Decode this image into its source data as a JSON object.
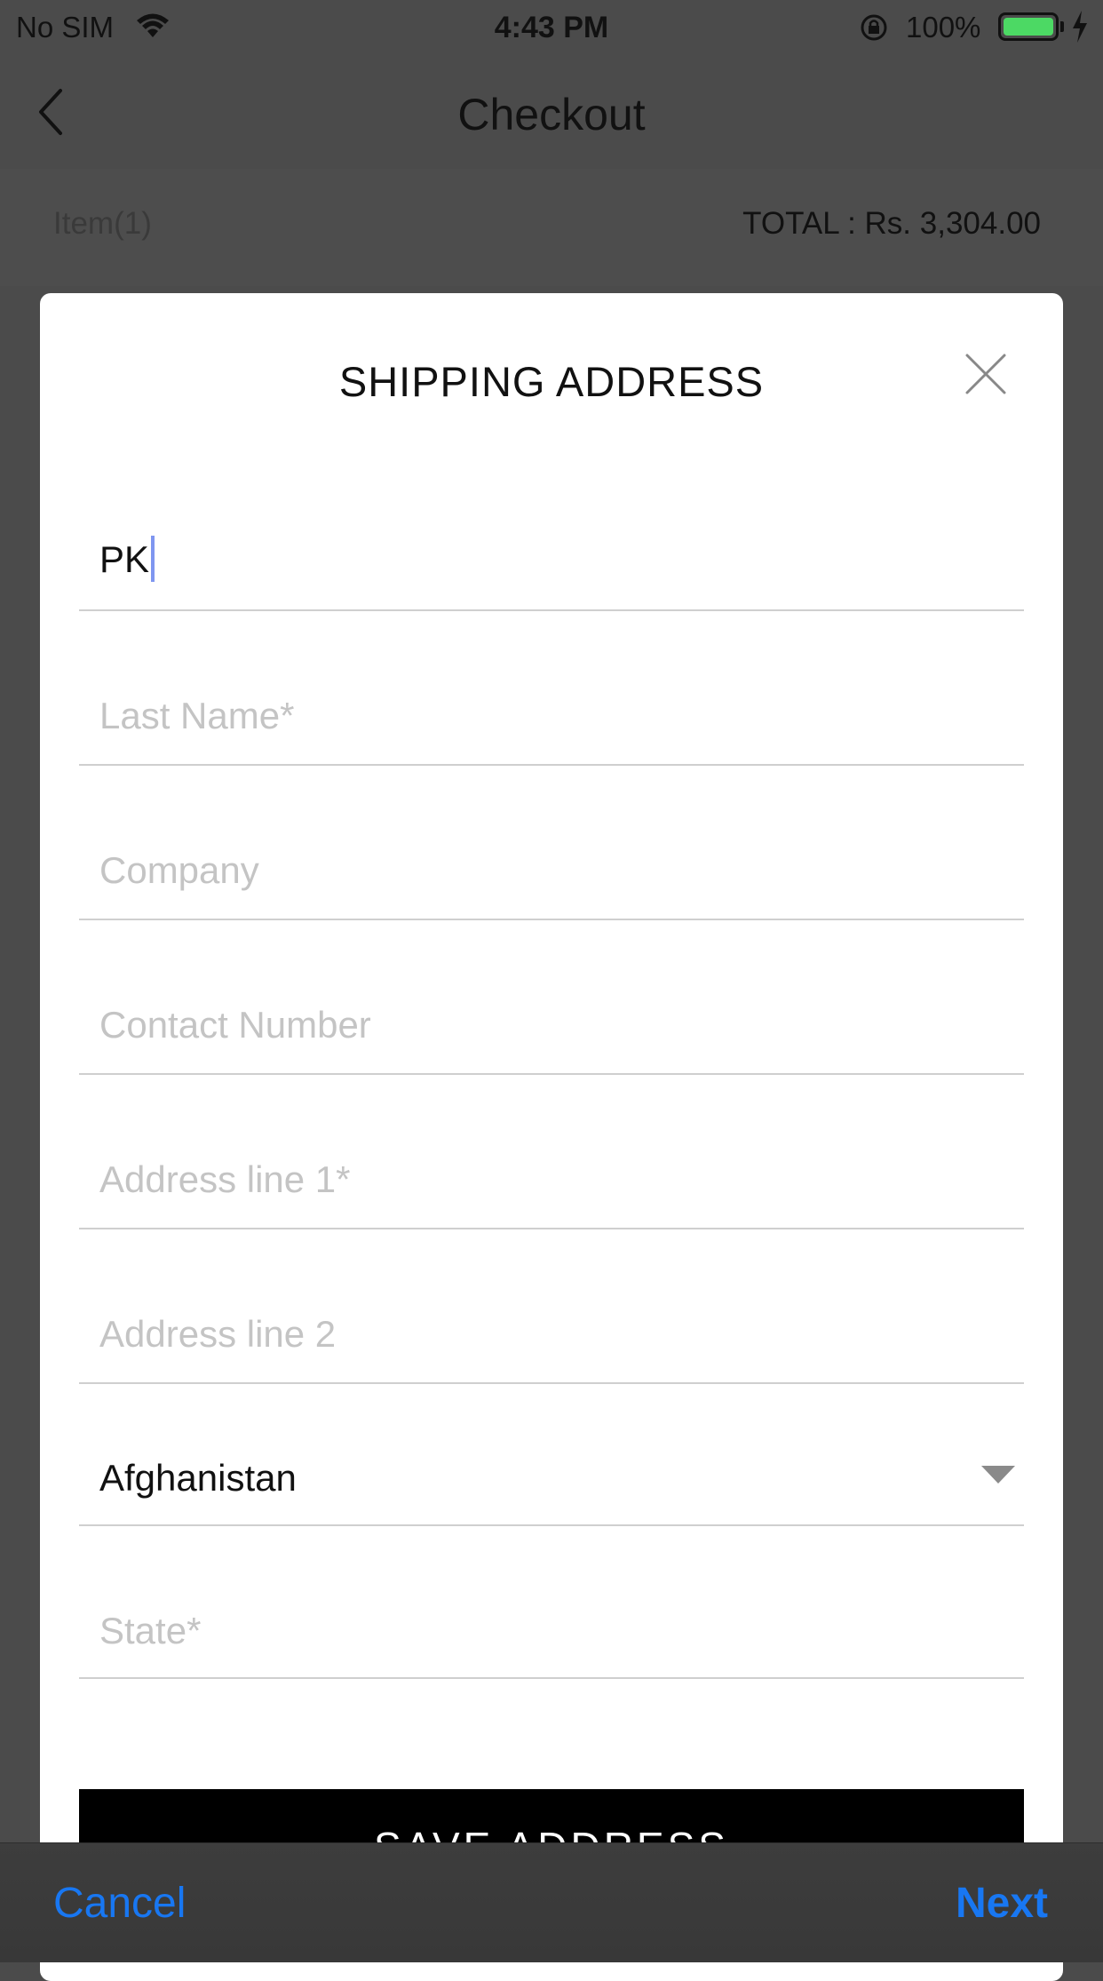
{
  "status_bar": {
    "carrier": "No SIM",
    "time": "4:43 PM",
    "battery_percent": "100%"
  },
  "nav": {
    "title": "Checkout"
  },
  "summary": {
    "items_label": "Item(1)",
    "total_label": "TOTAL : Rs. 3,304.00"
  },
  "modal": {
    "title": "SHIPPING ADDRESS",
    "fields": {
      "first_name_value": "PK",
      "last_name_placeholder": "Last Name*",
      "company_placeholder": "Company",
      "contact_placeholder": "Contact Number",
      "address1_placeholder": "Address line 1*",
      "address2_placeholder": "Address line 2",
      "country_value": "Afghanistan",
      "state_placeholder": "State*"
    },
    "save_label": "SAVE ADDRESS"
  },
  "accessory": {
    "cancel_label": "Cancel",
    "next_label": "Next"
  },
  "colors": {
    "accent": "#1877f2",
    "battery": "#4cd964",
    "caret": "#7f96f0"
  }
}
